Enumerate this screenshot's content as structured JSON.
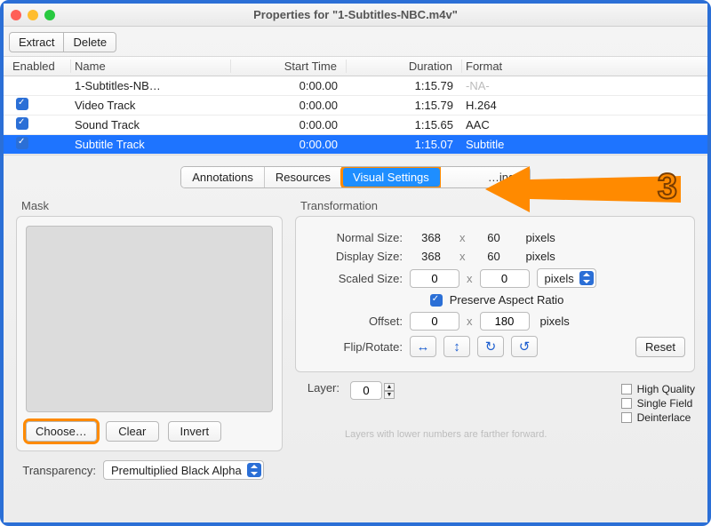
{
  "window": {
    "title": "Properties for \"1-Subtitles-NBC.m4v\""
  },
  "toolbar": {
    "extract": "Extract",
    "delete": "Delete"
  },
  "table": {
    "headers": {
      "enabled": "Enabled",
      "name": "Name",
      "start": "Start Time",
      "duration": "Duration",
      "format": "Format"
    },
    "rows": [
      {
        "enabled": null,
        "name": "1-Subtitles-NB…",
        "start": "0:00.00",
        "duration": "1:15.79",
        "format": "-NA-",
        "na": true
      },
      {
        "enabled": true,
        "name": "Video Track",
        "start": "0:00.00",
        "duration": "1:15.79",
        "format": "H.264"
      },
      {
        "enabled": true,
        "name": "Sound Track",
        "start": "0:00.00",
        "duration": "1:15.65",
        "format": "AAC"
      },
      {
        "enabled": true,
        "name": "Subtitle Track",
        "start": "0:00.00",
        "duration": "1:15.07",
        "format": "Subtitle",
        "selected": true
      }
    ]
  },
  "tabs": {
    "annotations": "Annotations",
    "resources": "Resources",
    "visual": "Visual Settings",
    "last_partial": "…ings"
  },
  "tutorial": {
    "step": "3"
  },
  "mask": {
    "title": "Mask",
    "choose": "Choose…",
    "clear": "Clear",
    "invert": "Invert",
    "transparency_label": "Transparency:",
    "transparency_value": "Premultiplied Black Alpha"
  },
  "trans": {
    "title": "Transformation",
    "normal_label": "Normal Size:",
    "display_label": "Display Size:",
    "scaled_label": "Scaled Size:",
    "offset_label": "Offset:",
    "fliprotate_label": "Flip/Rotate:",
    "x": "x",
    "pixels": "pixels",
    "normal_w": "368",
    "normal_h": "60",
    "display_w": "368",
    "display_h": "60",
    "scaled_w": "0",
    "scaled_h": "0",
    "scaled_unit": "pixels",
    "preserve": "Preserve Aspect Ratio",
    "offset_x": "0",
    "offset_y": "180",
    "reset": "Reset",
    "layer_label": "Layer:",
    "layer_value": "0",
    "hint": "Layers with lower numbers are farther forward.",
    "hq": "High Quality",
    "sf": "Single Field",
    "di": "Deinterlace"
  }
}
